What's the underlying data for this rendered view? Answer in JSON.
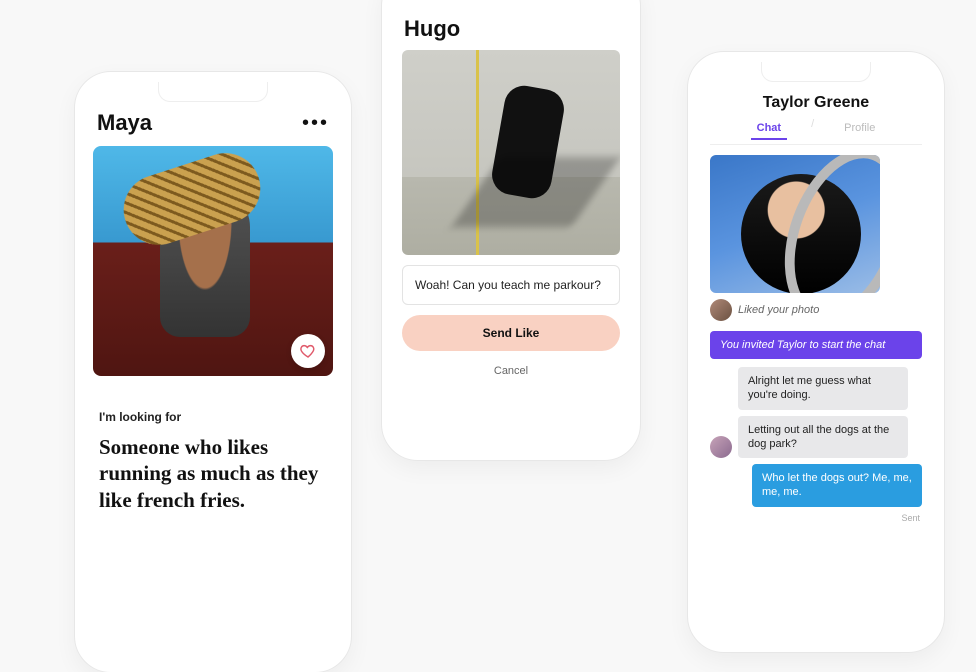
{
  "phone1": {
    "name": "Maya",
    "prompt_label": "I'm looking for",
    "prompt_text": "Someone who likes running as much as they like french fries."
  },
  "phone2": {
    "name": "Hugo",
    "message": "Woah! Can you teach me parkour?",
    "send_label": "Send Like",
    "cancel_label": "Cancel"
  },
  "phone3": {
    "name": "Taylor Greene",
    "tab_chat": "Chat",
    "tab_profile": "Profile",
    "liked_label": "Liked your photo",
    "system_msg": "You invited Taylor to start the chat",
    "msg1": "Alright let me guess what you're doing.",
    "msg2": "Letting out all the dogs at the dog park?",
    "msg3": "Who let the dogs out? Me, me, me, me.",
    "sent_label": "Sent"
  }
}
